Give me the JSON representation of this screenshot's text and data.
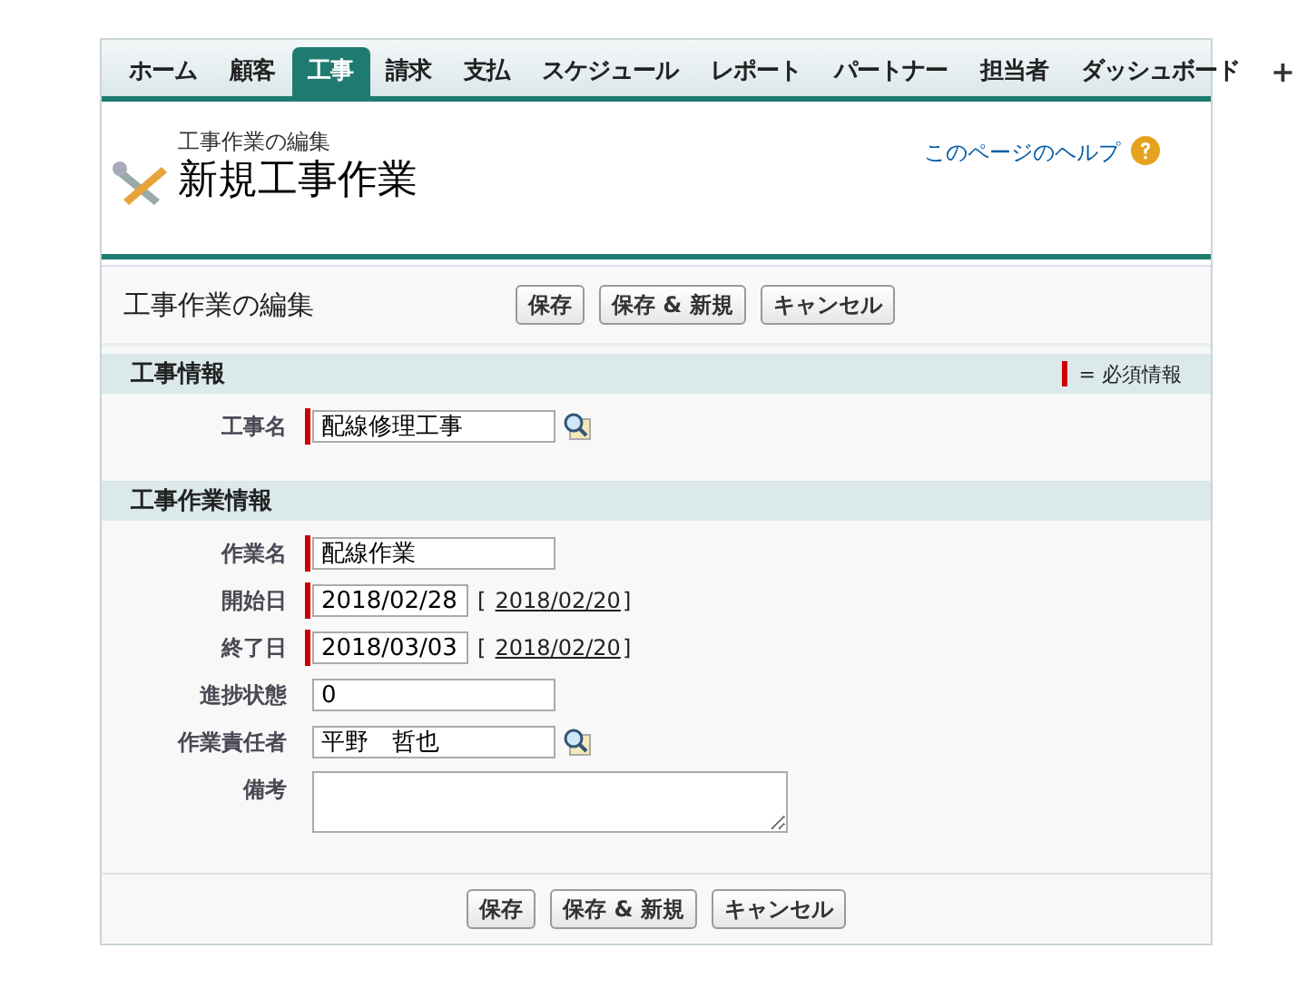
{
  "tabs": [
    {
      "label": "ホーム",
      "selected": false
    },
    {
      "label": "顧客",
      "selected": false
    },
    {
      "label": "工事",
      "selected": true
    },
    {
      "label": "請求",
      "selected": false
    },
    {
      "label": "支払",
      "selected": false
    },
    {
      "label": "スケジュール",
      "selected": false
    },
    {
      "label": "レポート",
      "selected": false
    },
    {
      "label": "パートナー",
      "selected": false
    },
    {
      "label": "担当者",
      "selected": false
    },
    {
      "label": "ダッシュボード",
      "selected": false
    }
  ],
  "add_tab": "+",
  "header": {
    "subtitle": "工事作業の編集",
    "title": "新規工事作業",
    "help_link": "このページのヘルプ"
  },
  "edit": {
    "title": "工事作業の編集",
    "buttons": [
      "保存",
      "保存 & 新規",
      "キャンセル"
    ],
    "required_legend": "= 必須情報",
    "sections": [
      {
        "title": "工事情報",
        "fields": [
          {
            "kind": "lookup",
            "label": "工事名",
            "value": "配線修理工事",
            "required": true
          }
        ]
      },
      {
        "title": "工事作業情報",
        "fields": [
          {
            "kind": "text",
            "label": "作業名",
            "value": "配線作業",
            "required": true
          },
          {
            "kind": "date",
            "label": "開始日",
            "value": "2018/02/28",
            "bracket_open": "[",
            "today": "2018/02/20",
            "bracket_close": "]",
            "required": true
          },
          {
            "kind": "date",
            "label": "終了日",
            "value": "2018/03/03",
            "bracket_open": "[",
            "today": "2018/02/20",
            "bracket_close": "]",
            "required": true
          },
          {
            "kind": "text",
            "label": "進捗状態",
            "value": "0",
            "required": false
          },
          {
            "kind": "lookup",
            "label": "作業責任者",
            "value": "平野　哲也",
            "required": false
          },
          {
            "kind": "textarea",
            "label": "備考",
            "required": false
          }
        ]
      }
    ],
    "bottom_buttons": [
      "保存",
      "保存 & 新規",
      "キャンセル"
    ]
  }
}
